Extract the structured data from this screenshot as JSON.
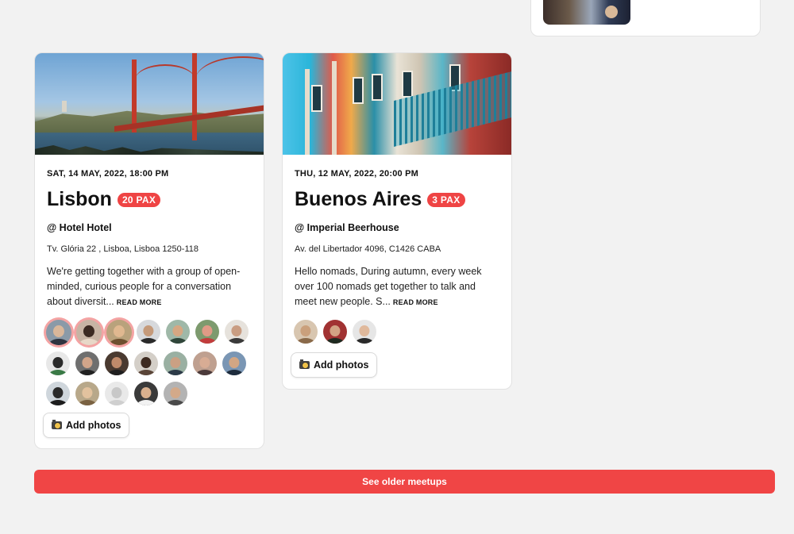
{
  "meetups": [
    {
      "date": "SAT, 14 MAY, 2022, 18:00 PM",
      "city": "Lisbon",
      "pax": "20 PAX",
      "venue": "@ Hotel Hotel",
      "address": "Tv. Glória 22 , Lisboa, Lisboa 1250-118",
      "description": "We're getting together with a group of open-minded, curious people for a conversation about diversit...",
      "read_more": "READ MORE",
      "add_photos_label": "Add photos",
      "attendee_count": 18
    },
    {
      "date": "THU, 12 MAY, 2022, 20:00 PM",
      "city": "Buenos Aires",
      "pax": "3 PAX",
      "venue": "@ Imperial Beerhouse",
      "address": "Av. del Libertador 4096, C1426 CABA",
      "description": "Hello nomads, During autumn, every week over 100 nomads get together to talk and meet new people. S...",
      "read_more": "READ MORE",
      "add_photos_label": "Add photos",
      "attendee_count": 3
    }
  ],
  "older_button_label": "See older meetups",
  "colors": {
    "accent": "#ef4444",
    "highlight_ring": "#f4a3a3",
    "background": "#f2f2f2"
  },
  "icons": {
    "add_photos": "camera-icon"
  }
}
